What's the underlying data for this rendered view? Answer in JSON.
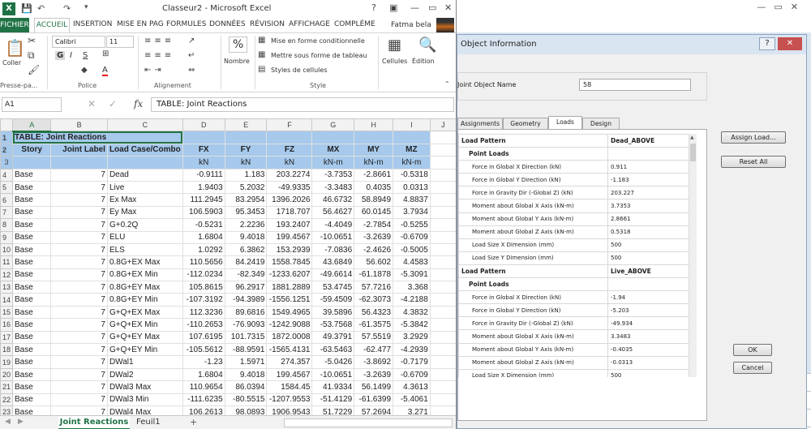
{
  "excel": {
    "title": "Classeur2 - Microsoft Excel",
    "logo": "X",
    "tabs": [
      "FICHIER",
      "ACCUEIL",
      "INSERTION",
      "MISE EN PAG",
      "FORMULES",
      "DONNÉES",
      "RÉVISION",
      "AFFICHAGE",
      "COMPLÉME"
    ],
    "user": "Fatma bela",
    "ribbon": {
      "paste": "Coller",
      "clipboard": "Presse-pa...",
      "font_name": "Calibri",
      "font_size": "11",
      "police": "Police",
      "alignment": "Alignement",
      "number": "Nombre",
      "cond_format": "Mise en forme conditionnelle",
      "table_format": "Mettre sous forme de tableau",
      "cell_styles": "Styles de cellules",
      "style": "Style",
      "cells": "Cellules",
      "edit": "Édition",
      "bold": "G",
      "italic": "I",
      "underline": "S",
      "font_color": "A",
      "percent": "%"
    },
    "name_box": "A1",
    "formula": "TABLE:  Joint Reactions",
    "fx": "fx",
    "columns": [
      "A",
      "B",
      "C",
      "D",
      "E",
      "F",
      "G",
      "H",
      "I",
      "J"
    ],
    "table_title": "TABLE:  Joint Reactions",
    "headers": [
      "Story",
      "Joint Label",
      "Load Case/Combo",
      "FX",
      "FY",
      "FZ",
      "MX",
      "MY",
      "MZ"
    ],
    "units": [
      "",
      "",
      "",
      "kN",
      "kN",
      "kN",
      "kN-m",
      "kN-m",
      "kN-m"
    ],
    "rows": [
      [
        "Base",
        "7",
        "Dead",
        "-0.9111",
        "1.183",
        "203.2274",
        "-3.7353",
        "-2.8661",
        "-0.5318"
      ],
      [
        "Base",
        "7",
        "Live",
        "1.9403",
        "5.2032",
        "-49.9335",
        "-3.3483",
        "0.4035",
        "0.0313"
      ],
      [
        "Base",
        "7",
        "Ex Max",
        "111.2945",
        "83.2954",
        "1396.2026",
        "46.6732",
        "58.8949",
        "4.8837"
      ],
      [
        "Base",
        "7",
        "Ey Max",
        "106.5903",
        "95.3453",
        "1718.707",
        "56.4627",
        "60.0145",
        "3.7934"
      ],
      [
        "Base",
        "7",
        "G+0.2Q",
        "-0.5231",
        "2.2236",
        "193.2407",
        "-4.4049",
        "-2.7854",
        "-0.5255"
      ],
      [
        "Base",
        "7",
        "ELU",
        "1.6804",
        "9.4018",
        "199.4567",
        "-10.0651",
        "-3.2639",
        "-0.6709"
      ],
      [
        "Base",
        "7",
        "ELS",
        "1.0292",
        "6.3862",
        "153.2939",
        "-7.0836",
        "-2.4626",
        "-0.5005"
      ],
      [
        "Base",
        "7",
        "0.8G+EX Max",
        "110.5656",
        "84.2419",
        "1558.7845",
        "43.6849",
        "56.602",
        "4.4583"
      ],
      [
        "Base",
        "7",
        "0.8G+EX Min",
        "-112.0234",
        "-82.349",
        "-1233.6207",
        "-49.6614",
        "-61.1878",
        "-5.3091"
      ],
      [
        "Base",
        "7",
        "0.8G+EY Max",
        "105.8615",
        "96.2917",
        "1881.2889",
        "53.4745",
        "57.7216",
        "3.368"
      ],
      [
        "Base",
        "7",
        "0.8G+EY Min",
        "-107.3192",
        "-94.3989",
        "-1556.1251",
        "-59.4509",
        "-62.3073",
        "-4.2188"
      ],
      [
        "Base",
        "7",
        "G+Q+EX Max",
        "112.3236",
        "89.6816",
        "1549.4965",
        "39.5896",
        "56.4323",
        "4.3832"
      ],
      [
        "Base",
        "7",
        "G+Q+EX Min",
        "-110.2653",
        "-76.9093",
        "-1242.9088",
        "-53.7568",
        "-61.3575",
        "-5.3842"
      ],
      [
        "Base",
        "7",
        "G+Q+EY Max",
        "107.6195",
        "101.7315",
        "1872.0008",
        "49.3791",
        "57.5519",
        "3.2929"
      ],
      [
        "Base",
        "7",
        "G+Q+EY Min",
        "-105.5612",
        "-88.9591",
        "-1565.4131",
        "-63.5463",
        "-62.477",
        "-4.2939"
      ],
      [
        "Base",
        "7",
        "DWal1",
        "-1.23",
        "1.5971",
        "274.357",
        "-5.0426",
        "-3.8692",
        "-0.7179"
      ],
      [
        "Base",
        "7",
        "DWal2",
        "1.6804",
        "9.4018",
        "199.4567",
        "-10.0651",
        "-3.2639",
        "-0.6709"
      ],
      [
        "Base",
        "7",
        "DWal3 Max",
        "110.9654",
        "86.0394",
        "1584.45",
        "41.9334",
        "56.1499",
        "4.3613"
      ],
      [
        "Base",
        "7",
        "DWal3 Min",
        "-111.6235",
        "-80.5515",
        "-1207.9553",
        "-51.4129",
        "-61.6399",
        "-5.4061"
      ],
      [
        "Base",
        "7",
        "DWal4 Max",
        "106.2613",
        "98.0893",
        "1906.9543",
        "51.7229",
        "57.2694",
        "3.271"
      ]
    ],
    "sheets": [
      "Joint Reactions",
      "Feuil1"
    ],
    "add_sheet": "+"
  },
  "dialog": {
    "title": "Object Information",
    "help": "?",
    "close": "✕",
    "joint_label": "Joint Object Name",
    "joint_value": "58",
    "tabs": [
      "Assignments",
      "Geometry",
      "Loads",
      "Design"
    ],
    "rows": [
      {
        "k": "Load Pattern",
        "v": "Dead_ABOVE",
        "t": "lp"
      },
      {
        "k": "Point Loads",
        "v": "",
        "t": "pl"
      },
      {
        "k": "Force in Global X Direction  (kN)",
        "v": "0.911",
        "t": "i"
      },
      {
        "k": "Force in Global Y Direction  (kN)",
        "v": "-1.183",
        "t": "i"
      },
      {
        "k": "Force in Gravity Dir (-Global Z)  (kN)",
        "v": "203.227",
        "t": "i"
      },
      {
        "k": "Moment about Global X Axis  (kN-m)",
        "v": "3.7353",
        "t": "i"
      },
      {
        "k": "Moment about Global Y Axis  (kN-m)",
        "v": "2.8661",
        "t": "i"
      },
      {
        "k": "Moment about Global Z Axis  (kN-m)",
        "v": "0.5318",
        "t": "i"
      },
      {
        "k": "Load Size X Dimension  (mm)",
        "v": "500",
        "t": "i"
      },
      {
        "k": "Load Size Y Dimension  (mm)",
        "v": "500",
        "t": "i"
      },
      {
        "k": "Load Pattern",
        "v": "Live_ABOVE",
        "t": "lp"
      },
      {
        "k": "Point Loads",
        "v": "",
        "t": "pl"
      },
      {
        "k": "Force in Global X Direction  (kN)",
        "v": "-1.94",
        "t": "i"
      },
      {
        "k": "Force in Global Y Direction  (kN)",
        "v": "-5.203",
        "t": "i"
      },
      {
        "k": "Force in Gravity Dir (-Global Z)  (kN)",
        "v": "-49.934",
        "t": "i"
      },
      {
        "k": "Moment about Global X Axis  (kN-m)",
        "v": "3.3483",
        "t": "i"
      },
      {
        "k": "Moment about Global Y Axis  (kN-m)",
        "v": "-0.4035",
        "t": "i"
      },
      {
        "k": "Moment about Global Z Axis  (kN-m)",
        "v": "-0.0313",
        "t": "i"
      },
      {
        "k": "Load Size X Dimension  (mm)",
        "v": "500",
        "t": "i"
      }
    ],
    "assign_load": "Assign Load...",
    "reset_all": "Reset All",
    "ok": "OK",
    "cancel": "Cancel"
  }
}
